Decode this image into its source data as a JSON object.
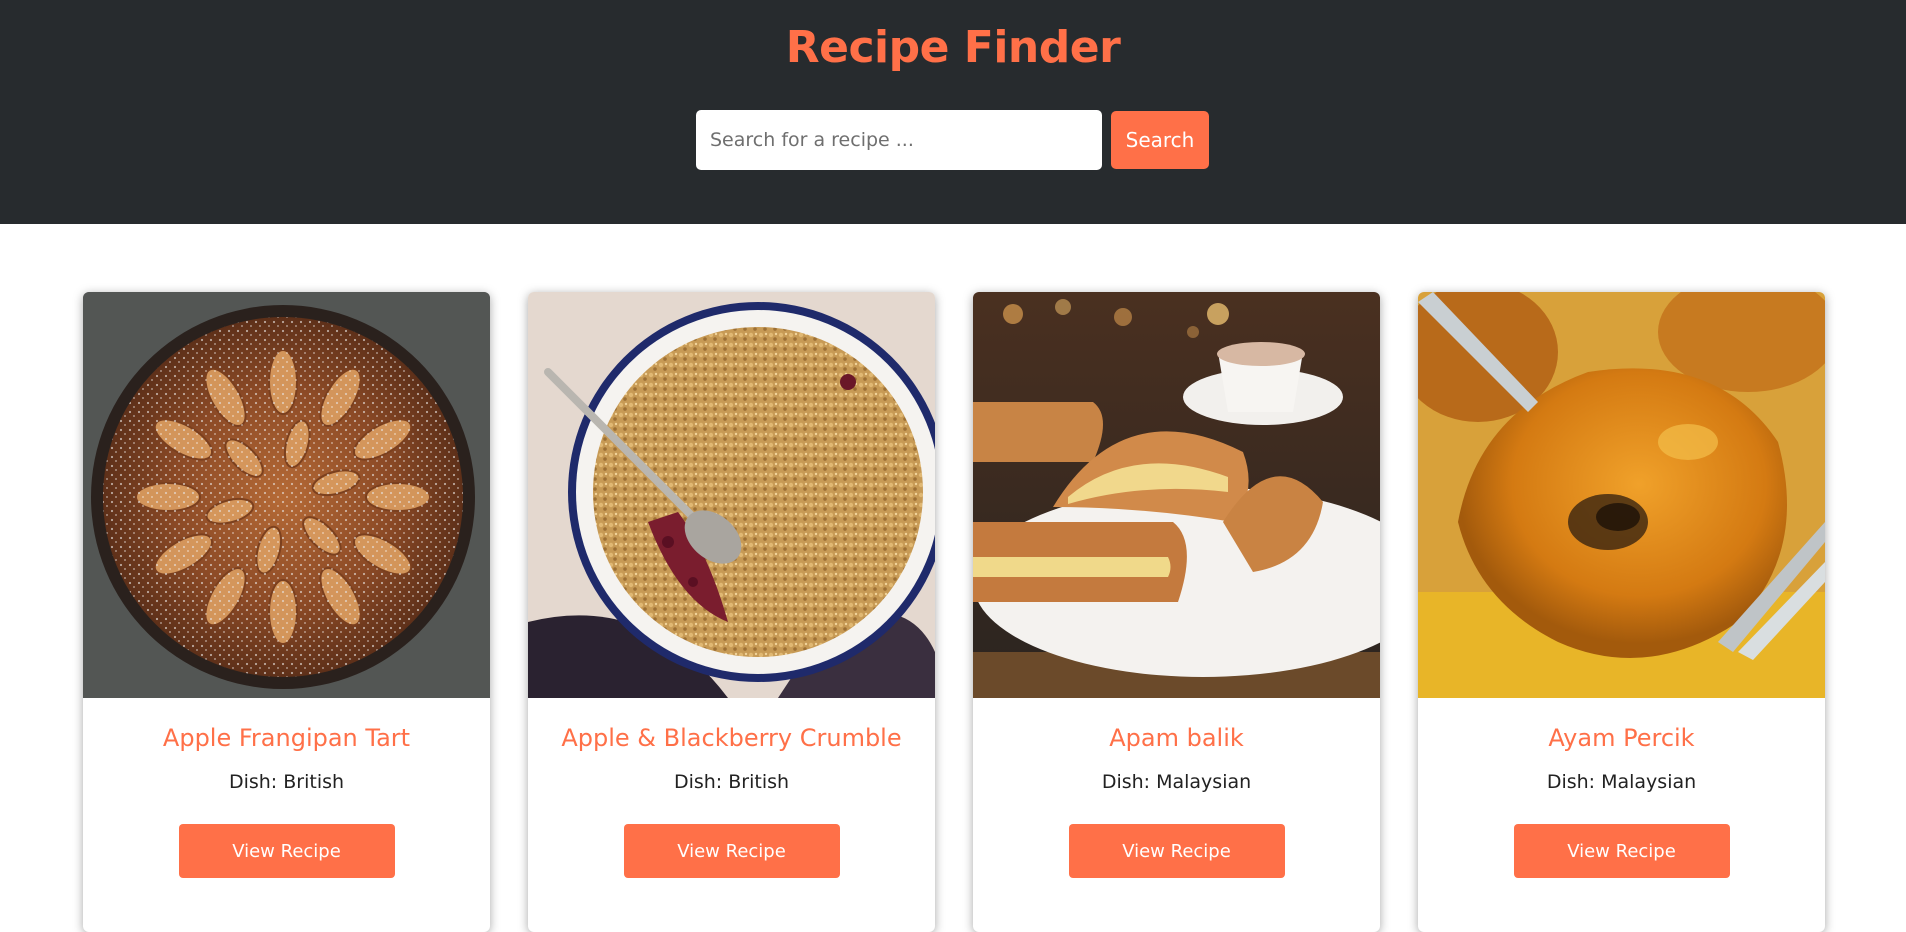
{
  "header": {
    "title": "Recipe Finder"
  },
  "search": {
    "placeholder": "Search for a recipe ...",
    "value": "",
    "button_label": "Search"
  },
  "colors": {
    "accent": "#ff7048",
    "header_bg": "#272b2e"
  },
  "recipes": [
    {
      "title": "Apple Frangipan Tart",
      "dish": "Dish: British",
      "button_label": "View Recipe",
      "image": "apple-frangipan-tart-photo"
    },
    {
      "title": "Apple & Blackberry Crumble",
      "dish": "Dish: British",
      "button_label": "View Recipe",
      "image": "apple-blackberry-crumble-photo"
    },
    {
      "title": "Apam balik",
      "dish": "Dish: Malaysian",
      "button_label": "View Recipe",
      "image": "apam-balik-photo"
    },
    {
      "title": "Ayam Percik",
      "dish": "Dish: Malaysian",
      "button_label": "View Recipe",
      "image": "ayam-percik-photo"
    }
  ]
}
